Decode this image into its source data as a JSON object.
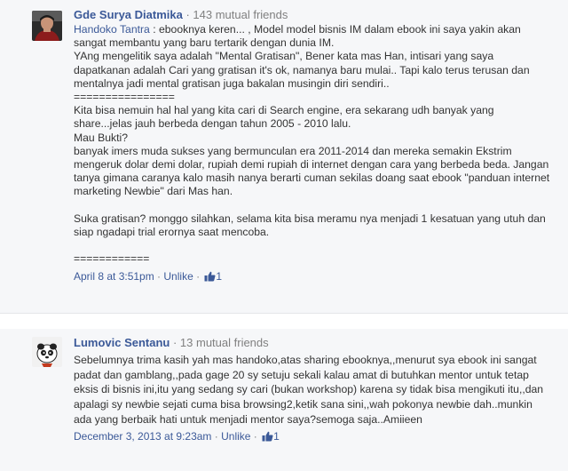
{
  "comments": [
    {
      "author": "Gde Surya Diatmika",
      "mutual": "· 143 mutual friends",
      "mention": "Handoko Tantra",
      "text": " : ebooknya keren... , Model model bisnis IM dalam ebook ini saya yakin akan sangat membantu yang baru tertarik dengan dunia IM.\nYAng mengelitik saya adalah \"Mental Gratisan\", Bener kata mas Han, intisari yang saya dapatkanan adalah Cari yang gratisan it's ok, namanya baru mulai.. Tapi kalo terus terusan dan mentalnya jadi mental gratisan juga bakalan musingin diri sendiri..\n================\nKita bisa nemuin hal hal yang kita cari di Search engine, era sekarang udh banyak yang share...jelas jauh berbeda dengan tahun 2005 - 2010 lalu.\nMau Bukti?\nbanyak imers muda sukses yang bermunculan era 2011-2014 dan mereka semakin Ekstrim mengeruk dolar demi dolar, rupiah demi rupiah di internet dengan cara yang berbeda beda. Jangan tanya gimana caranya kalo masih nanya berarti cuman sekilas doang saat ebook \"panduan internet marketing Newbie\" dari Mas han.\n\nSuka gratisan? monggo silahkan, selama kita bisa meramu nya menjadi 1 kesatuan yang utuh dan siap ngadapi trial erornya saat mencoba.\n\n============",
      "time": "April 8 at 3:51pm",
      "unlike": "Unlike",
      "likes": "1"
    },
    {
      "author": "Lumovic Sentanu",
      "mutual": "· 13 mutual friends",
      "text": "Sebelumnya trima kasih yah mas handoko,atas sharing ebooknya,,menurut sya ebook ini sangat padat dan gamblang,,pada gage 20 sy setuju sekali kalau amat di butuhkan mentor untuk tetap eksis di bisnis ini,itu yang sedang sy cari (bukan workshop) karena sy tidak bisa mengikuti itu,,dan apalagi sy newbie sejati cuma bisa browsing2,ketik sana sini,,wah pokonya newbie dah..munkin ada yang berbaik hati untuk menjadi mentor saya?semoga saja..Amiieen",
      "time": "December 3, 2013 at 9:23am",
      "unlike": "Unlike",
      "likes": "1"
    }
  ],
  "separator": " · ",
  "colors": {
    "link": "#3b5998",
    "meta": "#808080",
    "text": "#333333",
    "bg": "#f6f7f9"
  },
  "icons": {
    "like": "thumbs-up-icon"
  }
}
